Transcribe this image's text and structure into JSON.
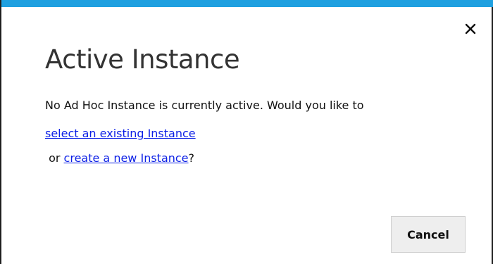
{
  "dialog": {
    "title": "Active Instance",
    "close_icon": "close-icon",
    "message": "No Ad Hoc Instance is currently active. Would you like to",
    "link_select": "select an existing Instance",
    "or_prefix": " or ",
    "link_create": "create a new Instance",
    "suffix": "?",
    "cancel_label": "Cancel",
    "colors": {
      "accent": "#1fa0e0",
      "link": "#0b1fe6",
      "button_bg": "#eeeeee"
    }
  }
}
